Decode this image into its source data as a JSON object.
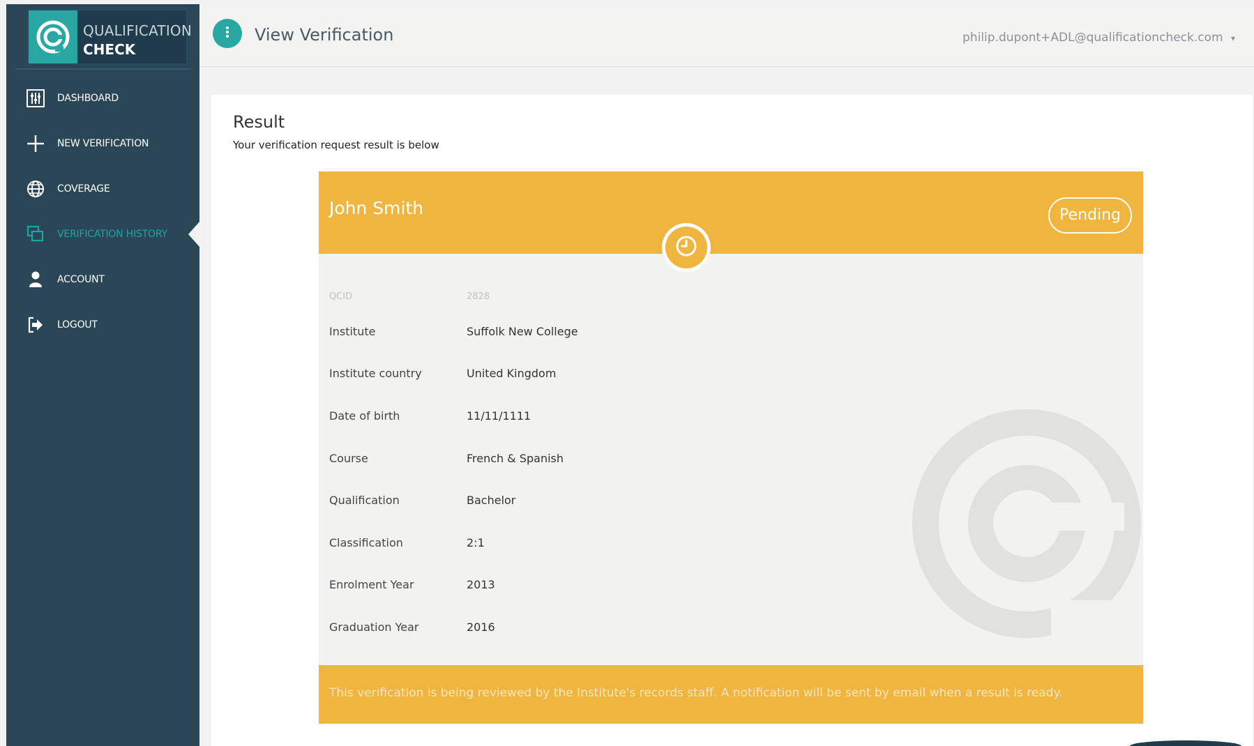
{
  "brand": {
    "line1": "QUALIFICATION",
    "line2": "CHECK"
  },
  "sidebar": {
    "items": [
      {
        "label": "DASHBOARD",
        "icon": "sliders-icon"
      },
      {
        "label": "NEW VERIFICATION",
        "icon": "plus-icon"
      },
      {
        "label": "COVERAGE",
        "icon": "globe-icon"
      },
      {
        "label": "VERIFICATION HISTORY",
        "icon": "history-icon",
        "active": true
      },
      {
        "label": "ACCOUNT",
        "icon": "user-icon"
      },
      {
        "label": "LOGOUT",
        "icon": "logout-icon"
      }
    ]
  },
  "header": {
    "title": "View Verification",
    "user_email": "philip.dupont+ADL@qualificationcheck.com",
    "user_menu_caret": "▾"
  },
  "result": {
    "title": "Result",
    "subtitle": "Your verification request result is below"
  },
  "card": {
    "name": "John Smith",
    "status": "Pending",
    "qcid_label": "QCID",
    "qcid_value": "2828",
    "fields": [
      {
        "label": "Institute",
        "value": "Suffolk New College"
      },
      {
        "label": "Institute country",
        "value": "United Kingdom"
      },
      {
        "label": "Date of birth",
        "value": "11/11/1111"
      },
      {
        "label": "Course",
        "value": "French & Spanish"
      },
      {
        "label": "Qualification",
        "value": "Bachelor"
      },
      {
        "label": "Classification",
        "value": "2:1"
      },
      {
        "label": "Enrolment Year",
        "value": "2013"
      },
      {
        "label": "Graduation Year",
        "value": "2016"
      }
    ],
    "footer_message": "This verification is being reviewed by the Institute's records staff. A notification will be sent by email when a result is ready."
  },
  "colors": {
    "sidebar_bg": "#2b4757",
    "accent_teal": "#2aa7a3",
    "pending_orange": "#f0b53f",
    "card_bg": "#f2f2f0"
  }
}
